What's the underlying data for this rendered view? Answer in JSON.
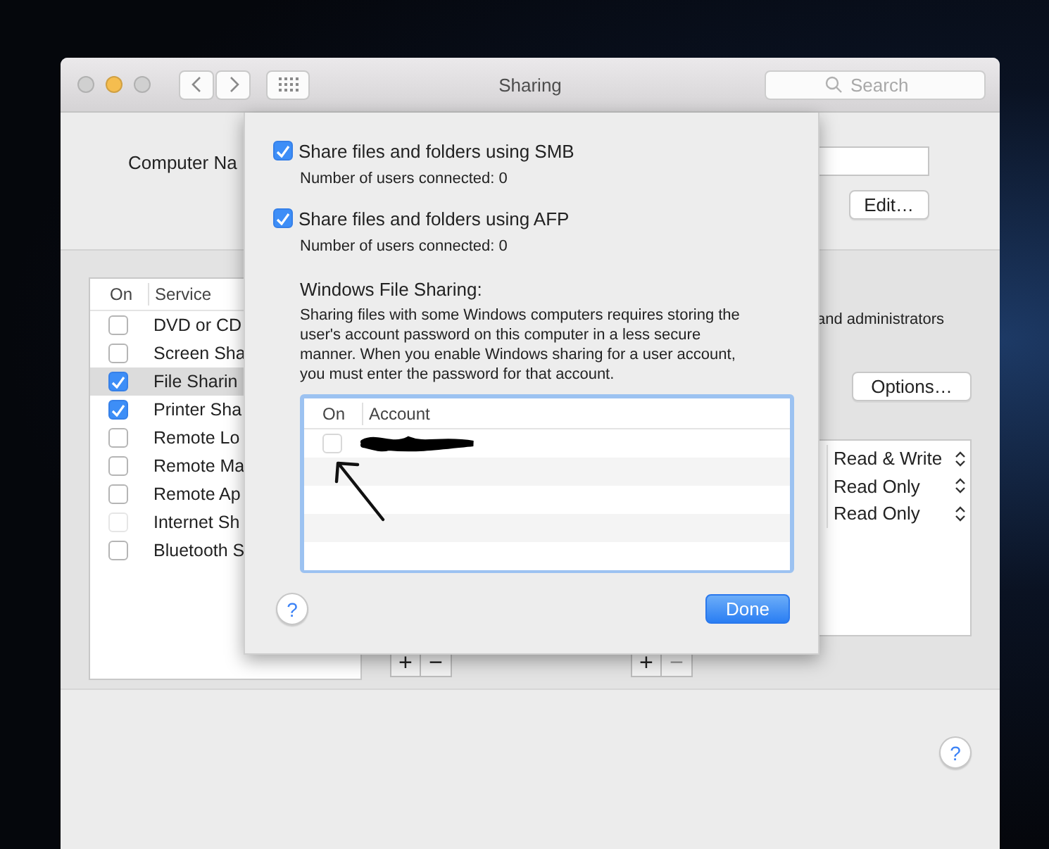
{
  "window": {
    "title": "Sharing",
    "search_placeholder": "Search",
    "help_button": "?"
  },
  "computer_name": {
    "label": "Computer Na",
    "edit_button": "Edit…"
  },
  "services": {
    "columns": [
      "On",
      "Service"
    ],
    "rows": [
      {
        "name": "DVD or CD",
        "checked": false,
        "selected": false,
        "disabled": false
      },
      {
        "name": "Screen Sha",
        "checked": false,
        "selected": false,
        "disabled": false
      },
      {
        "name": "File Sharin",
        "checked": true,
        "selected": true,
        "disabled": false
      },
      {
        "name": "Printer Sha",
        "checked": true,
        "selected": false,
        "disabled": false
      },
      {
        "name": "Remote Lo",
        "checked": false,
        "selected": false,
        "disabled": false
      },
      {
        "name": "Remote Ma",
        "checked": false,
        "selected": false,
        "disabled": false
      },
      {
        "name": "Remote Ap",
        "checked": false,
        "selected": false,
        "disabled": false
      },
      {
        "name": "Internet Sh",
        "checked": false,
        "selected": false,
        "disabled": true
      },
      {
        "name": "Bluetooth S",
        "checked": false,
        "selected": false,
        "disabled": false
      }
    ]
  },
  "access_note": "and administrators",
  "options_button": "Options…",
  "permissions": [
    "Read & Write",
    "Read Only",
    "Read Only"
  ],
  "list_controls": [
    {
      "add": "+",
      "remove": "−",
      "remove_disabled": false
    },
    {
      "add": "+",
      "remove": "−",
      "remove_disabled": true
    }
  ],
  "sheet": {
    "options": [
      {
        "label": "Share files and folders using SMB",
        "checked": true,
        "status": "Number of users connected: 0"
      },
      {
        "label": "Share files and folders using AFP",
        "checked": true,
        "status": "Number of users connected: 0"
      }
    ],
    "windows_heading": "Windows File Sharing:",
    "windows_text": "Sharing files with some Windows computers requires storing the user's account password on this computer in a less secure manner.  When you enable Windows sharing for a user account, you must enter the password for that account.",
    "accounts": {
      "columns": [
        "On",
        "Account"
      ],
      "rows": [
        {
          "checked": false
        }
      ]
    },
    "help_button": "?",
    "done_button": "Done"
  }
}
